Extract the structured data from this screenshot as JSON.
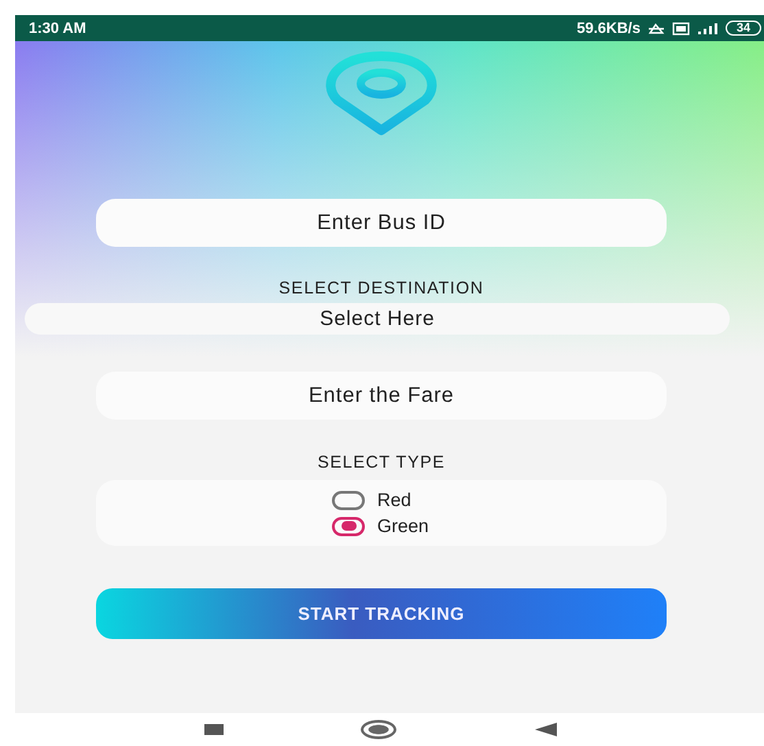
{
  "status_bar": {
    "time": "1:30 AM",
    "speed": "59.6KB/s",
    "battery": "34"
  },
  "bus_id_field": {
    "placeholder": "Enter Bus ID"
  },
  "destination": {
    "label": "SELECT DESTINATION",
    "value": "Select Here"
  },
  "fare_field": {
    "placeholder": "Enter the Fare"
  },
  "type": {
    "label": "SELECT TYPE",
    "options": [
      {
        "label": "Red",
        "selected": false
      },
      {
        "label": "Green",
        "selected": true
      }
    ]
  },
  "start_button": "START TRACKING"
}
